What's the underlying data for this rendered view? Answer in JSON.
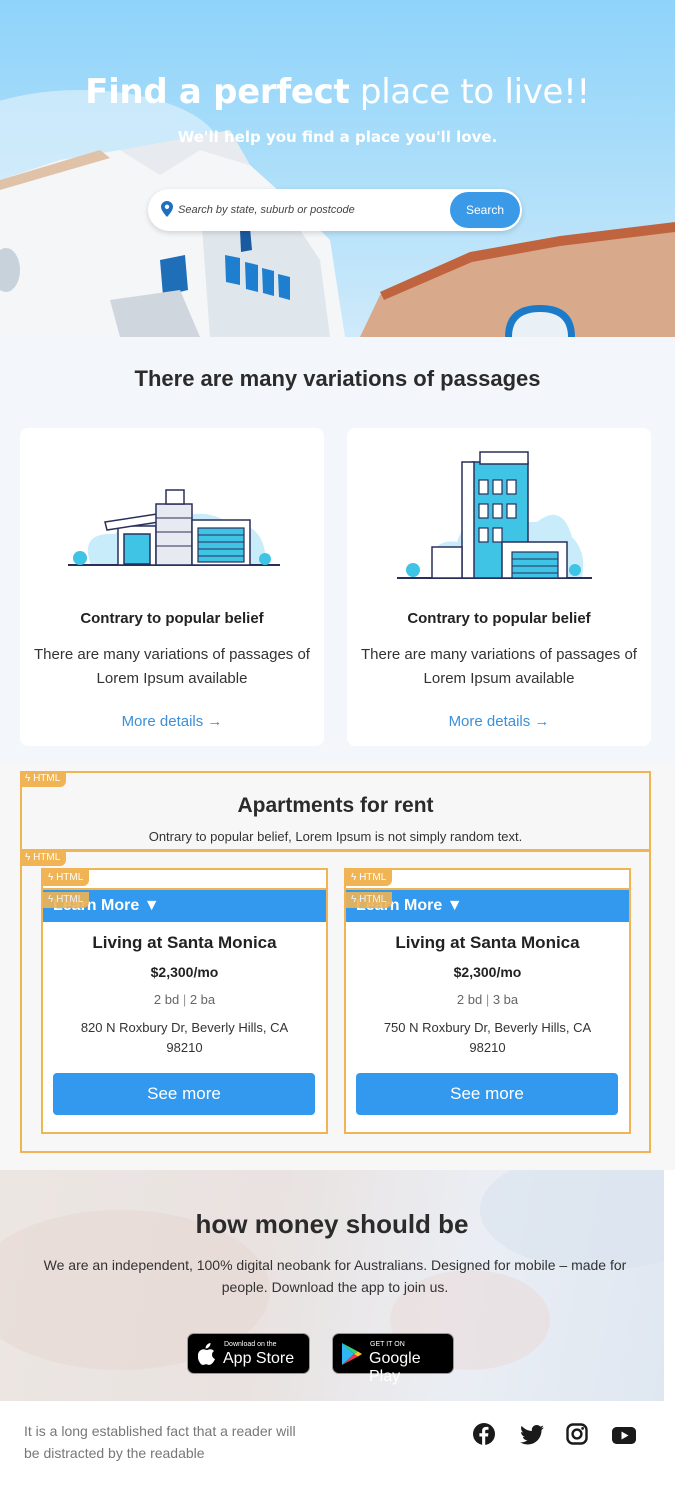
{
  "hero": {
    "title_bold": "Find a perfect",
    "title_light": "place to live!!",
    "subtitle": "We'll help you find a place you'll love.",
    "search_placeholder": "Search by state, suburb or postcode",
    "search_button": "Search"
  },
  "features": {
    "heading": "There are many variations of passages",
    "cards": [
      {
        "title": "Contrary to popular belief",
        "desc": "There are many variations of passages of Lorem Ipsum available",
        "link": "More details →"
      },
      {
        "title": "Contrary to popular belief",
        "desc": "There are many variations of passages of Lorem Ipsum available",
        "link": "More details →"
      }
    ]
  },
  "apartments": {
    "tag": "HTML",
    "title": "Apartments for rent",
    "subtitle": "Ontrary to popular belief, Lorem Ipsum is not simply random text.",
    "learn_more": "Learn More ▼",
    "listings": [
      {
        "name": "Living at Santa Monica",
        "price": "$2,300/mo",
        "beds": "2 bd",
        "baths": "2 ba",
        "address": "820 N Roxbury Dr, Beverly Hills, CA 98210",
        "button": "See more"
      },
      {
        "name": "Living at Santa Monica",
        "price": "$2,300/mo",
        "beds": "2 bd",
        "baths": "3 ba",
        "address": "750 N Roxbury Dr, Beverly Hills, CA 98210",
        "button": "See more"
      }
    ]
  },
  "money": {
    "heading": "how money should be",
    "text": "We are an independent, 100% digital neobank for Australians. Designed for mobile – made for people. Download the app to join us.",
    "app_store_small": "Download on the",
    "app_store_big": "App Store",
    "google_play_small": "GET IT ON",
    "google_play_big": "Google Play"
  },
  "footer": {
    "text": "It is a long established fact that a reader will be distracted by the readable",
    "social": [
      "facebook-icon",
      "twitter-icon",
      "instagram-icon",
      "youtube-icon"
    ]
  },
  "colors": {
    "accent": "#3299ee",
    "link": "#3b8fd9",
    "editor_tag": "#f0b455"
  }
}
